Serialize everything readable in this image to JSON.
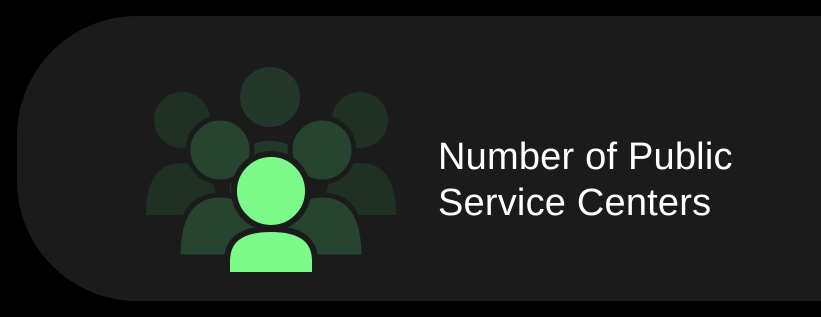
{
  "card": {
    "title_lines": [
      "Number of Public",
      "Service Centers"
    ]
  },
  "icon": {
    "name": "people-group-icon",
    "front_color": "#7dfb8a",
    "back_colors": [
      "#203323",
      "#253d29",
      "#2a452e"
    ]
  },
  "colors": {
    "page_background": "#000000",
    "card_background": "#1b1b1b",
    "text": "#ffffff"
  }
}
